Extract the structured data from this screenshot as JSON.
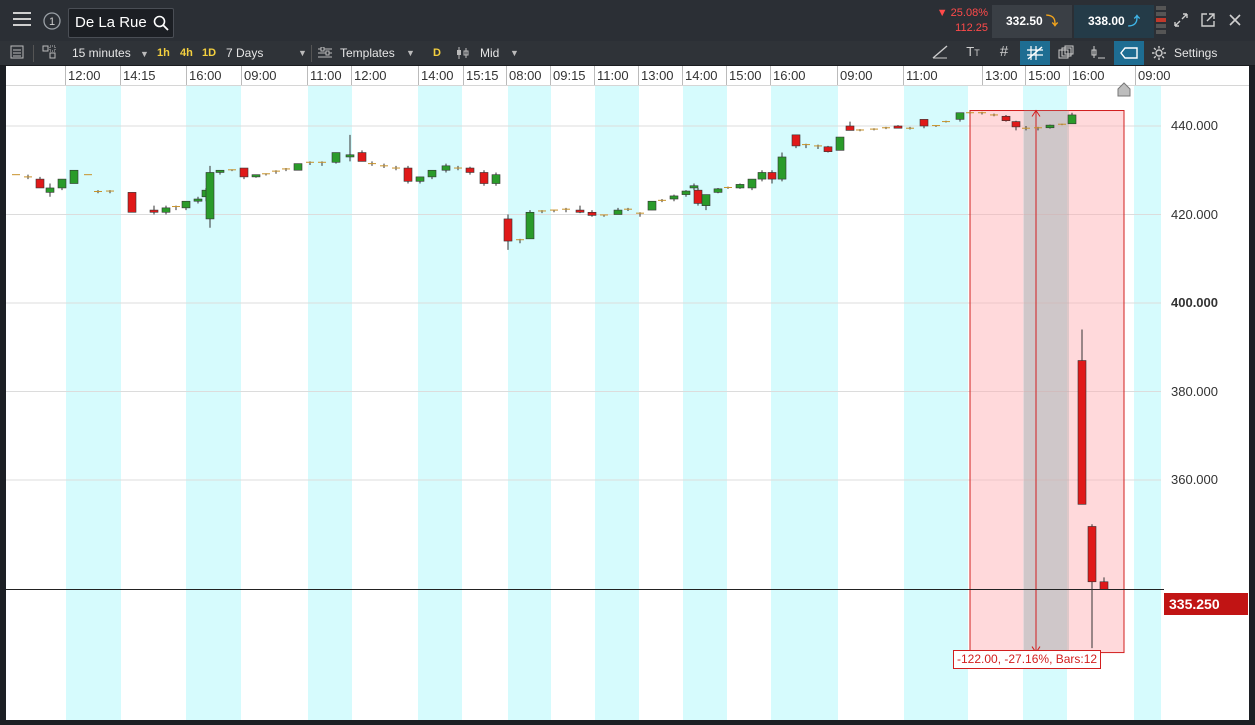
{
  "header": {
    "instrument": "De La Rue",
    "change_pct": "▼ 25.08%",
    "change_abs": "112.25",
    "sell_price": "332.50",
    "buy_price": "338.00"
  },
  "toolbar": {
    "interval": "15 minutes",
    "quick_1h": "1h",
    "quick_4h": "4h",
    "quick_1d": "1D",
    "range": "7 Days",
    "templates": "Templates",
    "d_badge": "D",
    "price_mode": "Mid",
    "settings": "Settings"
  },
  "colors": {
    "up": "#2a9b2a",
    "down": "#e01919",
    "session_band": "#d6fbfd",
    "measure": "#d21e1e"
  },
  "time_axis": [
    {
      "label": "12:00",
      "x": 62
    },
    {
      "label": "14:15",
      "x": 117
    },
    {
      "label": "16:00",
      "x": 183
    },
    {
      "label": "09:00",
      "x": 238
    },
    {
      "label": "11:00",
      "x": 304
    },
    {
      "label": "12:00",
      "x": 348
    },
    {
      "label": "14:00",
      "x": 415
    },
    {
      "label": "15:15",
      "x": 460
    },
    {
      "label": "08:00",
      "x": 503
    },
    {
      "label": "09:15",
      "x": 547
    },
    {
      "label": "11:00",
      "x": 591
    },
    {
      "label": "13:00",
      "x": 635
    },
    {
      "label": "14:00",
      "x": 679
    },
    {
      "label": "15:00",
      "x": 723
    },
    {
      "label": "16:00",
      "x": 767
    },
    {
      "label": "09:00",
      "x": 834
    },
    {
      "label": "11:00",
      "x": 900
    },
    {
      "label": "13:00",
      "x": 979
    },
    {
      "label": "15:00",
      "x": 1022
    },
    {
      "label": "16:00",
      "x": 1066
    },
    {
      "label": "09:00",
      "x": 1132
    }
  ],
  "price_axis": [
    {
      "label": "440.000",
      "value": 440,
      "bold": false
    },
    {
      "label": "420.000",
      "value": 420,
      "bold": false
    },
    {
      "label": "400.000",
      "value": 400,
      "bold": true
    },
    {
      "label": "380.000",
      "value": 380,
      "bold": false
    },
    {
      "label": "360.000",
      "value": 360,
      "bold": false
    }
  ],
  "current_price": "335.250",
  "measure": {
    "label": "-122.00, -27.16%, Bars:12"
  },
  "chart_data": {
    "type": "candlestick",
    "ylim": [
      310,
      450
    ],
    "current": 335.25,
    "candles": [
      {
        "o": 429,
        "h": 429,
        "l": 429,
        "c": 429
      },
      {
        "o": 428.5,
        "h": 429,
        "l": 428,
        "c": 428.5
      },
      {
        "o": 428,
        "h": 428.5,
        "l": 426,
        "c": 426
      },
      {
        "o": 425,
        "h": 427,
        "l": 424,
        "c": 426
      },
      {
        "o": 426,
        "h": 428,
        "l": 425.5,
        "c": 428
      },
      {
        "o": 427,
        "h": 430,
        "l": 427,
        "c": 430
      },
      {
        "o": 429,
        "h": 429,
        "l": 429,
        "c": 429
      },
      {
        "o": 425,
        "h": 425.5,
        "l": 424.8,
        "c": 425.2
      },
      {
        "o": 425,
        "h": 425.5,
        "l": 424.8,
        "c": 425.3
      },
      {
        "o": 425,
        "h": 425,
        "l": 424,
        "c": 420.5
      },
      {
        "o": 421,
        "h": 422,
        "l": 420,
        "c": 420.5
      },
      {
        "o": 420.5,
        "h": 422,
        "l": 420,
        "c": 421.5
      },
      {
        "o": 421.5,
        "h": 422,
        "l": 421,
        "c": 421.8
      },
      {
        "o": 421.5,
        "h": 423,
        "l": 421,
        "c": 423
      },
      {
        "o": 423,
        "h": 424,
        "l": 422.5,
        "c": 423.5
      },
      {
        "o": 424,
        "h": 426,
        "l": 423,
        "c": 425.5
      },
      {
        "o": 419,
        "h": 431,
        "l": 417,
        "c": 429.5
      },
      {
        "o": 429.5,
        "h": 430,
        "l": 429,
        "c": 430
      },
      {
        "o": 430,
        "h": 430.2,
        "l": 429.8,
        "c": 430.1
      },
      {
        "o": 430.5,
        "h": 430.5,
        "l": 428,
        "c": 428.5
      },
      {
        "o": 428.5,
        "h": 429,
        "l": 428.3,
        "c": 429
      },
      {
        "o": 429,
        "h": 429.3,
        "l": 428.8,
        "c": 429.2
      },
      {
        "o": 429.5,
        "h": 430,
        "l": 429.2,
        "c": 429.8
      },
      {
        "o": 430,
        "h": 430.5,
        "l": 429.8,
        "c": 430.3
      },
      {
        "o": 430,
        "h": 431.5,
        "l": 430,
        "c": 431.5
      },
      {
        "o": 431.5,
        "h": 432,
        "l": 431.2,
        "c": 431.8
      },
      {
        "o": 431.5,
        "h": 432,
        "l": 431,
        "c": 431.8
      },
      {
        "o": 431.8,
        "h": 434,
        "l": 431.5,
        "c": 434
      },
      {
        "o": 433,
        "h": 438,
        "l": 432,
        "c": 433.5
      },
      {
        "o": 434,
        "h": 434.5,
        "l": 432,
        "c": 432
      },
      {
        "o": 431.5,
        "h": 432,
        "l": 431,
        "c": 431.2
      },
      {
        "o": 431,
        "h": 431.5,
        "l": 430.5,
        "c": 431
      },
      {
        "o": 430.5,
        "h": 431,
        "l": 430,
        "c": 430.3
      },
      {
        "o": 430.5,
        "h": 431,
        "l": 427,
        "c": 427.5
      },
      {
        "o": 427.5,
        "h": 428.5,
        "l": 427,
        "c": 428.5
      },
      {
        "o": 428.5,
        "h": 430,
        "l": 428,
        "c": 430
      },
      {
        "o": 430,
        "h": 431.5,
        "l": 429.5,
        "c": 431
      },
      {
        "o": 430.5,
        "h": 431,
        "l": 430,
        "c": 430.5
      },
      {
        "o": 430.5,
        "h": 430.8,
        "l": 429,
        "c": 429.5
      },
      {
        "o": 429.5,
        "h": 430,
        "l": 426.5,
        "c": 427
      },
      {
        "o": 427,
        "h": 429.5,
        "l": 426.5,
        "c": 429
      },
      {
        "o": 419,
        "h": 420,
        "l": 412,
        "c": 414
      },
      {
        "o": 414,
        "h": 414.5,
        "l": 413.5,
        "c": 414.3
      },
      {
        "o": 414.5,
        "h": 421,
        "l": 414.5,
        "c": 420.5
      },
      {
        "o": 420.5,
        "h": 421,
        "l": 420.3,
        "c": 420.8
      },
      {
        "o": 420.8,
        "h": 421,
        "l": 420.5,
        "c": 421
      },
      {
        "o": 421,
        "h": 421.5,
        "l": 420.5,
        "c": 421.2
      },
      {
        "o": 421,
        "h": 422,
        "l": 420.3,
        "c": 420.5
      },
      {
        "o": 420.5,
        "h": 421,
        "l": 419.5,
        "c": 419.8
      },
      {
        "o": 419.8,
        "h": 420,
        "l": 419.5,
        "c": 419.9
      },
      {
        "o": 420,
        "h": 421.5,
        "l": 420,
        "c": 421
      },
      {
        "o": 421,
        "h": 421.5,
        "l": 420.8,
        "c": 421.2
      },
      {
        "o": 420,
        "h": 420.5,
        "l": 419.5,
        "c": 420.3
      },
      {
        "o": 421,
        "h": 423,
        "l": 421,
        "c": 423
      },
      {
        "o": 423,
        "h": 423.5,
        "l": 422.8,
        "c": 423.2
      },
      {
        "o": 423.5,
        "h": 424.5,
        "l": 423,
        "c": 424.2
      },
      {
        "o": 424.5,
        "h": 425.5,
        "l": 424,
        "c": 425.3
      },
      {
        "o": 426,
        "h": 427,
        "l": 425.5,
        "c": 426.5
      },
      {
        "o": 425.5,
        "h": 426,
        "l": 422,
        "c": 422.5
      },
      {
        "o": 422,
        "h": 424.5,
        "l": 421,
        "c": 424.5
      },
      {
        "o": 425,
        "h": 426,
        "l": 424.8,
        "c": 425.8
      },
      {
        "o": 426,
        "h": 426.3,
        "l": 425.8,
        "c": 426.1
      },
      {
        "o": 426,
        "h": 427,
        "l": 425.8,
        "c": 426.8
      },
      {
        "o": 426,
        "h": 428,
        "l": 425.5,
        "c": 428
      },
      {
        "o": 428,
        "h": 430,
        "l": 427.5,
        "c": 429.5
      },
      {
        "o": 429.5,
        "h": 430,
        "l": 427,
        "c": 428
      },
      {
        "o": 428,
        "h": 434,
        "l": 427.5,
        "c": 433
      },
      {
        "o": 438,
        "h": 438,
        "l": 435,
        "c": 435.5
      },
      {
        "o": 435.5,
        "h": 436,
        "l": 435,
        "c": 435.8
      },
      {
        "o": 435.5,
        "h": 435.8,
        "l": 434.8,
        "c": 435.3
      },
      {
        "o": 435.3,
        "h": 435.5,
        "l": 434,
        "c": 434.2
      },
      {
        "o": 434.5,
        "h": 437.5,
        "l": 434.5,
        "c": 437.5
      },
      {
        "o": 440,
        "h": 441,
        "l": 439,
        "c": 439
      },
      {
        "o": 439,
        "h": 439.3,
        "l": 438.8,
        "c": 439.1
      },
      {
        "o": 439.2,
        "h": 439.5,
        "l": 439,
        "c": 439.3
      },
      {
        "o": 439.5,
        "h": 439.8,
        "l": 439.3,
        "c": 439.6
      },
      {
        "o": 440,
        "h": 440.2,
        "l": 439.5,
        "c": 439.5
      },
      {
        "o": 439.5,
        "h": 439.8,
        "l": 439.2,
        "c": 439.5
      },
      {
        "o": 441.5,
        "h": 441.5,
        "l": 439.5,
        "c": 440
      },
      {
        "o": 440,
        "h": 440.2,
        "l": 439.8,
        "c": 440.1
      },
      {
        "o": 441,
        "h": 441.2,
        "l": 440.8,
        "c": 441
      },
      {
        "o": 441.5,
        "h": 443,
        "l": 441,
        "c": 443
      },
      {
        "o": 443,
        "h": 443.2,
        "l": 442.8,
        "c": 443
      },
      {
        "o": 443,
        "h": 443.2,
        "l": 442.6,
        "c": 442.8
      },
      {
        "o": 442.5,
        "h": 442.8,
        "l": 442.2,
        "c": 442.4
      },
      {
        "o": 442.2,
        "h": 442.5,
        "l": 441,
        "c": 441.2
      },
      {
        "o": 441,
        "h": 441.2,
        "l": 439,
        "c": 439.8
      },
      {
        "o": 439.5,
        "h": 440,
        "l": 439,
        "c": 439.2
      },
      {
        "o": 439.2,
        "h": 439.8,
        "l": 439,
        "c": 439.6
      },
      {
        "o": 439.6,
        "h": 440.3,
        "l": 439.4,
        "c": 440.2
      },
      {
        "o": 440.3,
        "h": 440.5,
        "l": 440.2,
        "c": 440.4
      },
      {
        "o": 440.5,
        "h": 443,
        "l": 440.5,
        "c": 442.5
      },
      {
        "o": 387,
        "h": 394,
        "l": 354.5,
        "c": 354.5
      },
      {
        "o": 349.5,
        "h": 350,
        "l": 322,
        "c": 337
      },
      {
        "o": 337,
        "h": 338,
        "l": 335.3,
        "c": 335.3
      }
    ],
    "candle_x": [
      10,
      22,
      34,
      44,
      56,
      68,
      82,
      92,
      104,
      126,
      148,
      160,
      170,
      180,
      192,
      200,
      204,
      214,
      226,
      238,
      250,
      260,
      270,
      280,
      292,
      304,
      316,
      330,
      344,
      356,
      366,
      378,
      390,
      402,
      414,
      426,
      440,
      452,
      464,
      478,
      490,
      502,
      514,
      524,
      536,
      548,
      560,
      574,
      586,
      598,
      612,
      622,
      634,
      646,
      656,
      668,
      680,
      688,
      692,
      700,
      712,
      722,
      734,
      746,
      756,
      766,
      776,
      790,
      800,
      812,
      822,
      834,
      844,
      854,
      868,
      880,
      892,
      904,
      918,
      930,
      940,
      954,
      964,
      976,
      988,
      1000,
      1010,
      1020,
      1032,
      1044,
      1056,
      1066,
      1076,
      1086,
      1098,
      1110
    ],
    "session_bands": [
      [
        60,
        115
      ],
      [
        180,
        235
      ],
      [
        302,
        346
      ],
      [
        412,
        456
      ],
      [
        502,
        545
      ],
      [
        589,
        633
      ],
      [
        677,
        721
      ],
      [
        765,
        832
      ],
      [
        898,
        962
      ],
      [
        1017,
        1061
      ],
      [
        1128,
        1155
      ]
    ],
    "measure_box": {
      "x0": 964,
      "x1": 1118,
      "top_value": 443.5,
      "bottom_value": 321
    },
    "measure_highlight": {
      "x0": 1018,
      "x1": 1063
    }
  }
}
